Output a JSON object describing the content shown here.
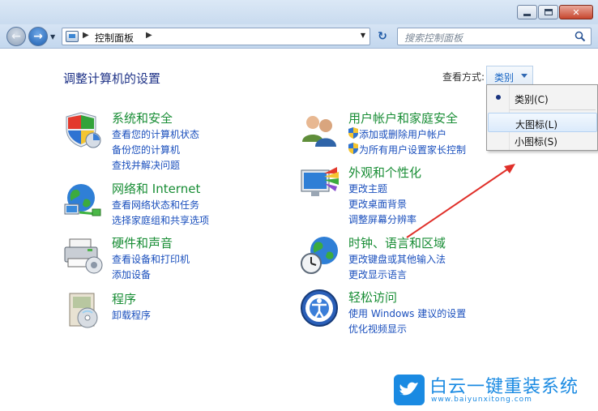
{
  "window": {
    "address": {
      "path_label": "控制面板"
    },
    "search": {
      "placeholder": "搜索控制面板"
    }
  },
  "main": {
    "title": "调整计算机的设置",
    "view_by": {
      "label": "查看方式:",
      "selected": "类别"
    },
    "view_menu": {
      "items": [
        {
          "label": "类别(C)",
          "checked": true
        },
        {
          "label": "大图标(L)",
          "highlighted": true
        },
        {
          "label": "小图标(S)"
        }
      ]
    },
    "categories": [
      {
        "title": "系统和安全",
        "icon": "system-security-icon",
        "links": [
          "查看您的计算机状态",
          "备份您的计算机",
          "查找并解决问题"
        ]
      },
      {
        "title": "网络和 Internet",
        "icon": "network-icon",
        "links": [
          "查看网络状态和任务",
          "选择家庭组和共享选项"
        ]
      },
      {
        "title": "硬件和声音",
        "icon": "hardware-sound-icon",
        "links": [
          "查看设备和打印机",
          "添加设备"
        ]
      },
      {
        "title": "程序",
        "icon": "programs-icon",
        "links": [
          "卸载程序"
        ]
      },
      {
        "title": "用户帐户和家庭安全",
        "icon": "user-accounts-icon",
        "links": [
          "添加或删除用户帐户",
          "为所有用户设置家长控制"
        ]
      },
      {
        "title": "外观和个性化",
        "icon": "appearance-icon",
        "links": [
          "更改主题",
          "更改桌面背景",
          "调整屏幕分辨率"
        ]
      },
      {
        "title": "时钟、语言和区域",
        "icon": "clock-region-icon",
        "links": [
          "更改键盘或其他输入法",
          "更改显示语言"
        ]
      },
      {
        "title": "轻松访问",
        "icon": "ease-of-access-icon",
        "links": [
          "使用 Windows 建议的设置",
          "优化视频显示"
        ]
      }
    ]
  },
  "watermark": {
    "main": "白云一键重装系统",
    "sub": "www.baiyunxitong.com"
  },
  "colors": {
    "accent_link": "#1a4fbd",
    "category_title": "#188d35",
    "title": "#1e3287",
    "annotation_arrow": "#e0302a"
  }
}
